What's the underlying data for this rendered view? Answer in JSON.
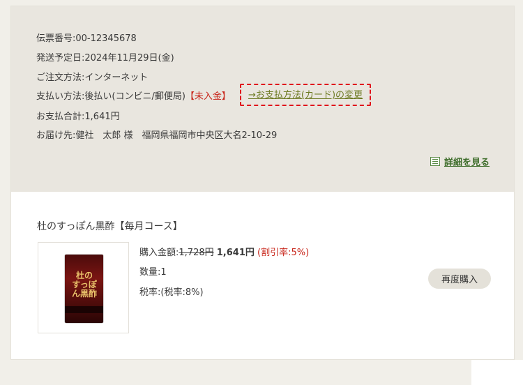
{
  "order": {
    "slip_label": "伝票番号:",
    "slip_value": "00-12345678",
    "ship_label": "発送予定日:",
    "ship_value": "2024年11月29日(金)",
    "method_label": "ご注文方法:",
    "method_value": "インターネット",
    "pay_label": "支払い方法:",
    "pay_value": "後払い(コンビニ/郵便局)",
    "pay_status": "【未入金】",
    "change_payment": "→お支払方法(カード)の変更",
    "total_label": "お支払合計:",
    "total_value": "1,641円",
    "dest_label": "お届け先:",
    "dest_value": "健社　太郎 様　福岡県福岡市中央区大名2-10-29",
    "detail_link": "詳細を見る"
  },
  "product": {
    "title": "杜のすっぽん黒酢【毎月コース】",
    "package_text": "杜のすっぽん黒酢",
    "price_label": "購入金額:",
    "price_old": "1,728円",
    "price_new": "1,641円",
    "discount": "(割引率:5%)",
    "qty_label": "数量:",
    "qty_value": "1",
    "tax_label": "税率:",
    "tax_value": "(税率:8%)",
    "rebuy_button": "再度購入"
  },
  "colors": {
    "accent_red": "#c8261b",
    "link_green": "#3f6e2c",
    "panel_bg": "#e9e6df"
  }
}
